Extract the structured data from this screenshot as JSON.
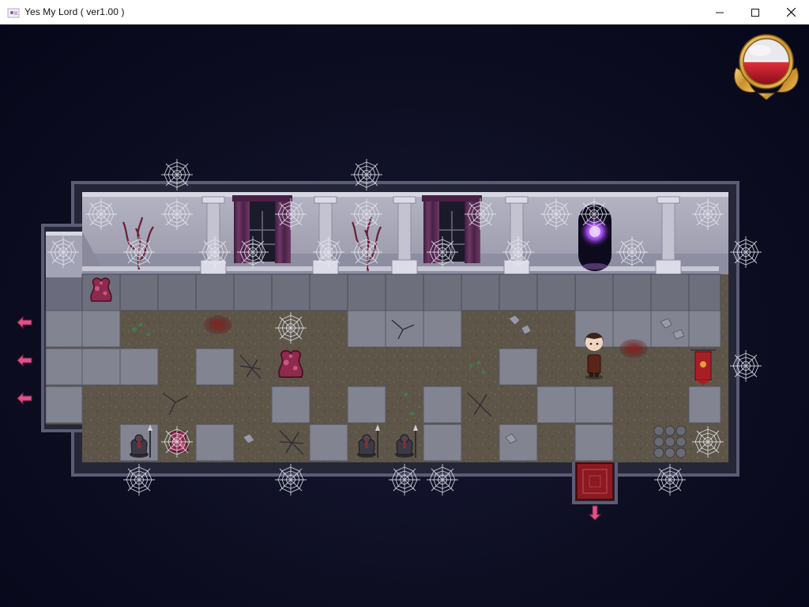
{
  "window": {
    "title": "Yes My Lord ( ver1.00 )",
    "minimize_icon": "minimize-icon",
    "maximize_icon": "maximize-icon",
    "close_icon": "close-icon"
  },
  "game": {
    "hud": {
      "orb": "health-orb",
      "orb_fill_fraction": 0.5,
      "orb_colors": {
        "top": "#e8e8ee",
        "bottom": "#c8182a",
        "frame": "#d8a640"
      }
    },
    "exits": {
      "west": [
        "west-exit-arrow",
        "west-exit-arrow",
        "west-exit-arrow"
      ],
      "south": "south-exit-arrow",
      "arrow_color": "#e0508a"
    },
    "player": {
      "sprite": "player-character"
    },
    "colors": {
      "wall": "#a7a7b9",
      "floor_stone": "#7c7c86",
      "floor_dirt": "#5d5548",
      "curtain": "#5a2a52",
      "carpet": "#8a1a22",
      "portal": "#a050e8"
    }
  }
}
